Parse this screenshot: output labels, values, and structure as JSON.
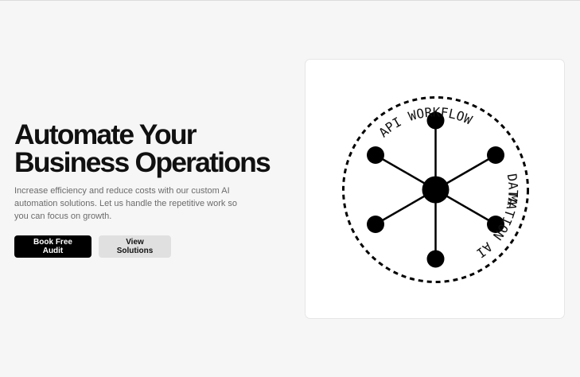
{
  "hero": {
    "headline_line1": "Automate Your",
    "headline_line2": "Business Operations",
    "subtext": "Increase efficiency and reduce costs with our custom AI automation solutions. Let us handle the repetitive work so you can focus on growth."
  },
  "buttons": {
    "primary_label": "Book Free Audit",
    "secondary_label": "View Solutions"
  },
  "illustration": {
    "ring_words": [
      "WORKFLOW",
      "DATA",
      "AUTOMATION AI",
      "API"
    ],
    "icon": "network-hub-icon"
  },
  "colors": {
    "background": "#f6f6f6",
    "card": "#ffffff",
    "primary_button": "#000000",
    "secondary_button": "#e0e0e0",
    "text": "#111111",
    "muted_text": "#6b6b6b"
  }
}
